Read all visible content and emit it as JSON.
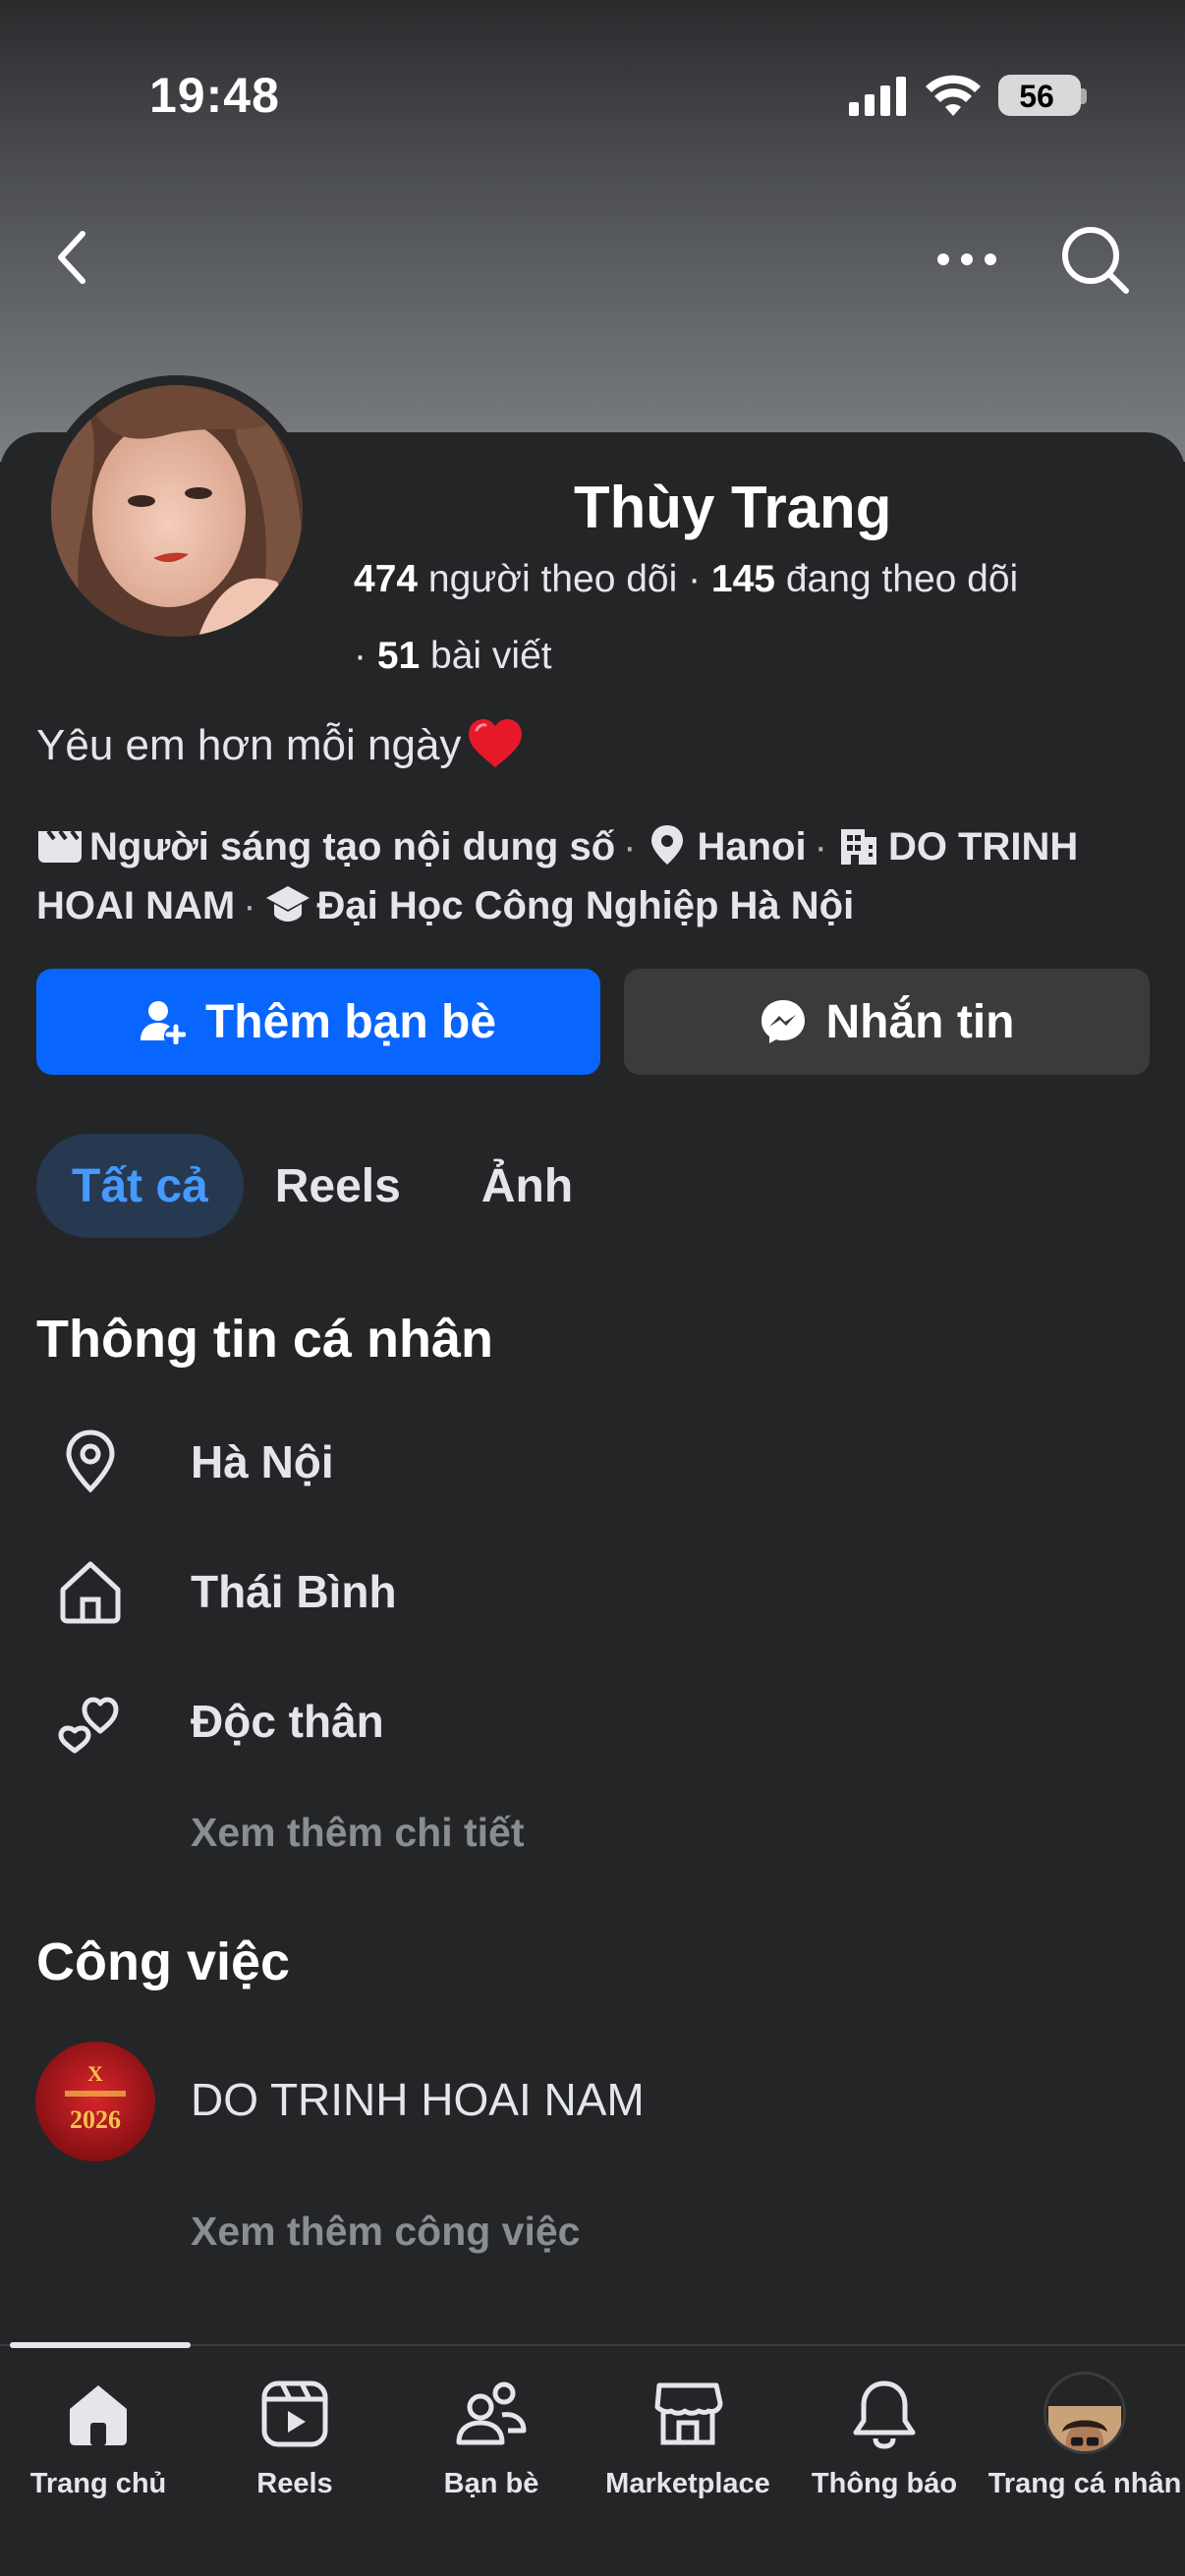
{
  "status_bar": {
    "time": "19:48",
    "battery": "56"
  },
  "header": {
    "back_icon": "chevron-left-icon",
    "more_icon": "ellipsis-icon",
    "search_icon": "search-icon"
  },
  "profile": {
    "name": "Thùy Trang",
    "followers_count": "474",
    "followers_label": " người theo dõi · ",
    "following_count": "145",
    "following_label": " đang theo dõi",
    "posts_prefix": "· ",
    "posts_count": "51",
    "posts_label": " bài viết",
    "bio": "Yêu em hơn mỗi ngày",
    "meta": {
      "creator": "Người sáng tạo nội dung số",
      "location": "Hanoi",
      "work": "DO TRINH HOAI NAM",
      "school": "Đại Học Công Nghiệp Hà Nội"
    }
  },
  "actions": {
    "add_friend": "Thêm bạn bè",
    "message": "Nhắn tin"
  },
  "tabs": [
    {
      "label": "Tất cả",
      "active": true
    },
    {
      "label": "Reels",
      "active": false
    },
    {
      "label": "Ảnh",
      "active": false
    }
  ],
  "personal_info": {
    "title": "Thông tin cá nhân",
    "items": [
      {
        "icon": "location-pin-icon",
        "text": "Hà Nội"
      },
      {
        "icon": "home-icon",
        "text": "Thái Bình"
      },
      {
        "icon": "relationship-hearts-icon",
        "text": "Độc thân"
      }
    ],
    "see_more": "Xem thêm chi tiết"
  },
  "work": {
    "title": "Công việc",
    "company": "DO TRINH HOAI NAM",
    "logo_text": "2026",
    "see_more": "Xem thêm công việc"
  },
  "bottom_nav": [
    {
      "label": "Trang chủ",
      "icon": "home-icon"
    },
    {
      "label": "Reels",
      "icon": "reels-icon"
    },
    {
      "label": "Bạn bè",
      "icon": "friends-icon"
    },
    {
      "label": "Marketplace",
      "icon": "marketplace-icon"
    },
    {
      "label": "Thông báo",
      "icon": "bell-icon"
    },
    {
      "label": "Trang cá nhân",
      "icon": "profile-avatar"
    }
  ],
  "colors": {
    "accent": "#0866ff",
    "background": "#242526",
    "tab_active_bg": "#263951",
    "tab_active_text": "#4599ff"
  }
}
